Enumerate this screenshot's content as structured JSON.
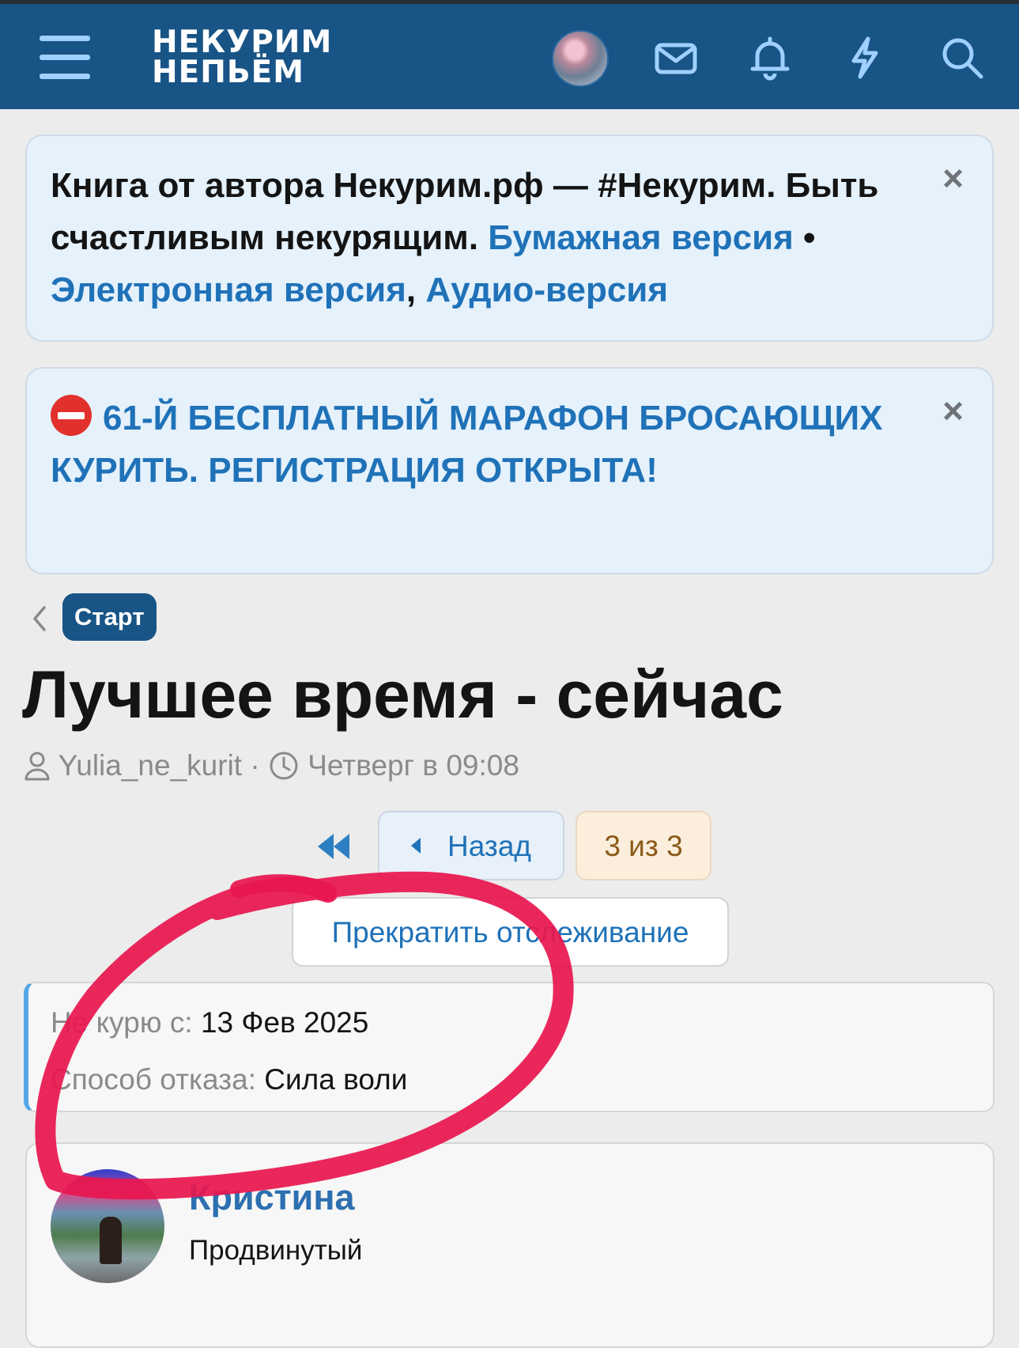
{
  "header": {
    "logo_line1": "НЕКУРИМ",
    "logo_line2": "НЕПЬЁМ",
    "icons": [
      "menu-icon",
      "avatar",
      "mail-icon",
      "bell-icon",
      "bolt-icon",
      "search-icon"
    ],
    "bar_color": "#185486"
  },
  "notice_book": {
    "text_prefix": "Книга от автора Некурим.рф — #Некурим. Быть счастливым некурящим. ",
    "link_paper": "Бумажная версия",
    "sep_bullet": " • ",
    "link_ebook": "Электронная версия",
    "comma": ", ",
    "link_audio": "Аудио-версия",
    "close": "×"
  },
  "notice_marathon": {
    "icon": "no-entry-icon",
    "text": "61-Й БЕСПЛАТНЫЙ МАРАФОН БРОСАЮЩИХ КУРИТЬ. РЕГИСТРАЦИЯ ОТКРЫТА!",
    "close": "×"
  },
  "breadcrumb": {
    "label": "Старт"
  },
  "thread": {
    "title": "Лучшее время - сейчас",
    "author": "Yulia_ne_kurit",
    "separator": " · ",
    "date": "Четверг в 09:08"
  },
  "pagination": {
    "back_label": "Назад",
    "pages_label": "3 из 3"
  },
  "watch": {
    "unwatch_label": "Прекратить отслеживание"
  },
  "info": {
    "quit_since_label": "Не курю с: ",
    "quit_since_value": "13 Фев 2025",
    "method_label": "Способ отказа: ",
    "method_value": "Сила воли"
  },
  "post": {
    "username": "Кристина",
    "rank": "Продвинутый"
  },
  "colors": {
    "accent": "#1f72b8",
    "marker": "#e8174f"
  }
}
